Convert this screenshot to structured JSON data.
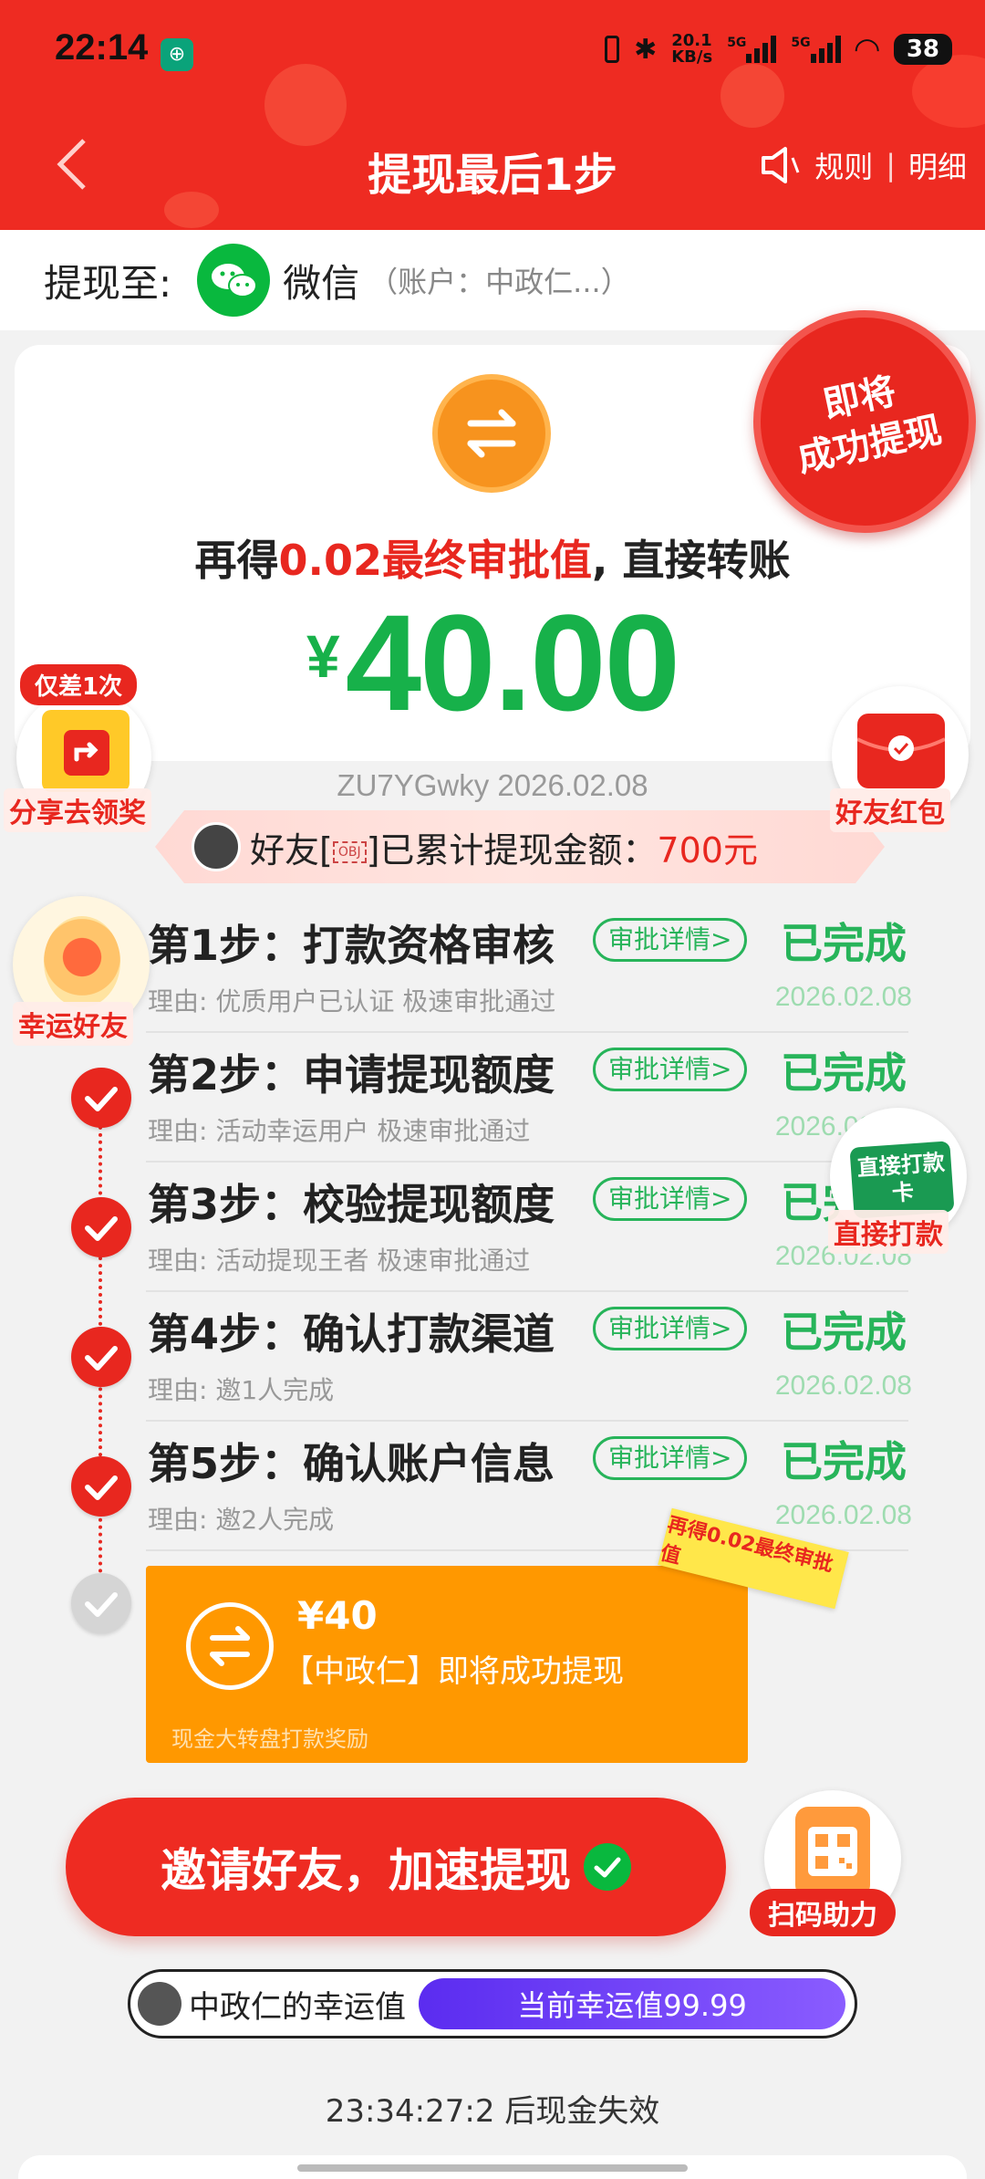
{
  "status_bar": {
    "time": "22:14",
    "app_icon": "bank-app-icon",
    "net_speed_top": "20.1",
    "net_speed_bottom": "KB/s",
    "sig1": "5G",
    "sig2": "5G",
    "battery": "38"
  },
  "nav": {
    "title": "提现最后1步",
    "rules": "规则",
    "separator": "|",
    "details": "明细"
  },
  "withdraw_to": {
    "label": "提现至:",
    "method": "微信",
    "account": "（账户：中政仁...）"
  },
  "card": {
    "headline_before": "再得",
    "headline_red": "0.02最终审批值",
    "headline_after": ", 直接转账",
    "currency": "¥",
    "amount": "40.00",
    "seal_line1": "即将",
    "seal_line2": "成功提现"
  },
  "stamp_line": "ZU7YGwky 2026.02.08",
  "friend_banner": {
    "before": "好友[",
    "obj": "OBJ",
    "after": "]已累计提现金额：",
    "amount": "700元"
  },
  "steps": [
    {
      "title": "第1步：打款资格审核",
      "detail": "审批详情>",
      "status": "已完成",
      "reason": "理由: 优质用户已认证 极速审批通过",
      "date": "2026.02.08"
    },
    {
      "title": "第2步：申请提现额度",
      "detail": "审批详情>",
      "status": "已完成",
      "reason": "理由: 活动幸运用户 极速审批通过",
      "date": "2026.02.08"
    },
    {
      "title": "第3步：校验提现额度",
      "detail": "审批详情>",
      "status": "已完成",
      "reason": "理由: 活动提现王者 极速审批通过",
      "date": "2026.02.08"
    },
    {
      "title": "第4步：确认打款渠道",
      "detail": "审批详情>",
      "status": "已完成",
      "reason": "理由: 邀1人完成",
      "date": "2026.02.08"
    },
    {
      "title": "第5步：确认账户信息",
      "detail": "审批详情>",
      "status": "已完成",
      "reason": "理由: 邀2人完成",
      "date": "2026.02.08"
    }
  ],
  "final": {
    "amount": "¥40",
    "text": "【中政仁】即将成功提现",
    "sub": "现金大转盘打款奖励",
    "tag": "再得0.02最终审批值"
  },
  "invite_button": "邀请好友，加速提现",
  "luck": {
    "name": "中政仁的幸运值",
    "value": "当前幸运值99.99"
  },
  "countdown": "23:34:27:2 后现金失效",
  "floats": {
    "share_badge": "仅差1次",
    "share_label": "分享去领奖",
    "friend_redpack_label": "好友红包",
    "lucky_friend_label": "幸运好友",
    "direct_card_text": "直接打款卡",
    "direct_pay_label": "直接打款",
    "scan_label": "扫码助力"
  },
  "colors": {
    "brand_red": "#ee2b22",
    "money_green": "#17b14a",
    "orange": "#ff9800",
    "purple": "#6a3cf5"
  }
}
